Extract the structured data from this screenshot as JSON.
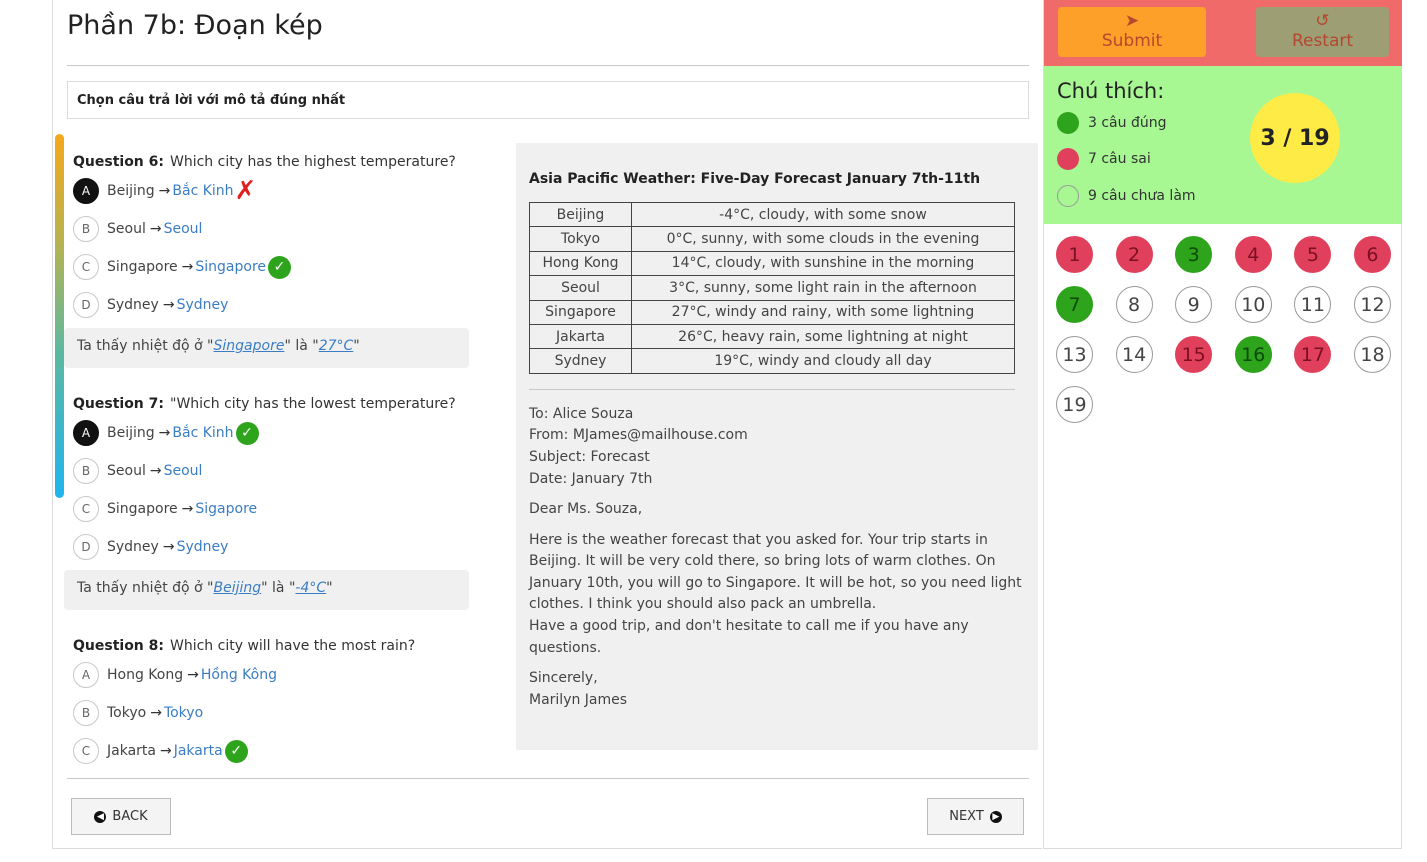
{
  "page_title": "Phần 7b: Đoạn kép",
  "instruction": "Chọn câu trả lời với mô tả đúng nhất",
  "questions": [
    {
      "label": "Question 6:",
      "text": "Which city has the highest temperature?",
      "options": [
        {
          "letter": "A",
          "text": "Beijing",
          "translation": "Bắc Kinh",
          "selected": true,
          "mark": "wrong"
        },
        {
          "letter": "B",
          "text": "Seoul",
          "translation": "Seoul",
          "selected": false,
          "mark": ""
        },
        {
          "letter": "C",
          "text": "Singapore",
          "translation": "Singapore",
          "selected": false,
          "mark": "correct"
        },
        {
          "letter": "D",
          "text": "Sydney",
          "translation": "Sydney",
          "selected": false,
          "mark": ""
        }
      ],
      "explain_prefix": "Ta thấy nhiệt độ ở \"",
      "explain_city": "Singapore",
      "explain_mid": "\" là \"",
      "explain_value": "27°C",
      "explain_suffix": "\""
    },
    {
      "label": "Question 7:",
      "text": "\"Which city has the lowest temperature?",
      "options": [
        {
          "letter": "A",
          "text": "Beijing",
          "translation": "Bắc Kinh",
          "selected": true,
          "mark": "correct"
        },
        {
          "letter": "B",
          "text": "Seoul",
          "translation": "Seoul",
          "selected": false,
          "mark": ""
        },
        {
          "letter": "C",
          "text": "Singapore",
          "translation": "Sigapore",
          "selected": false,
          "mark": ""
        },
        {
          "letter": "D",
          "text": "Sydney",
          "translation": "Sydney",
          "selected": false,
          "mark": ""
        }
      ],
      "explain_prefix": "Ta thấy nhiệt độ ở \"",
      "explain_city": "Beijing",
      "explain_mid": "\" là \"",
      "explain_value": "-4°C",
      "explain_suffix": "\""
    },
    {
      "label": "Question 8:",
      "text": "Which city will have the most rain?",
      "options": [
        {
          "letter": "A",
          "text": "Hong Kong",
          "translation": "Hồng Kông",
          "selected": false,
          "mark": ""
        },
        {
          "letter": "B",
          "text": "Tokyo",
          "translation": "Tokyo",
          "selected": false,
          "mark": ""
        },
        {
          "letter": "C",
          "text": "Jakarta",
          "translation": "Jakarta",
          "selected": false,
          "mark": "correct"
        }
      ]
    }
  ],
  "passage": {
    "title": "Asia Pacific Weather: Five-Day Forecast January 7th-11th",
    "table": [
      [
        "Beijing",
        "-4°C, cloudy, with some snow"
      ],
      [
        "Tokyo",
        "0°C, sunny, with some clouds in the evening"
      ],
      [
        "Hong Kong",
        "14°C, cloudy, with sunshine in the morning"
      ],
      [
        "Seoul",
        "3°C, sunny, some light rain in the afternoon"
      ],
      [
        "Singapore",
        "27°C, windy and rainy, with some lightning"
      ],
      [
        "Jakarta",
        "26°C, heavy rain, some lightning at night"
      ],
      [
        "Sydney",
        "19°C, windy and cloudy all day"
      ]
    ],
    "email": {
      "to": "To: Alice Souza",
      "from": "From: MJames@mailhouse.com",
      "subject": "Subject: Forecast",
      "date": "Date: January 7th",
      "greeting": "Dear Ms. Souza,",
      "body1": "Here is the weather forecast that you asked for. Your trip starts in Beijing. It will be very cold there, so bring lots of warm clothes. On January 10th, you will go to Singapore. It will be hot, so you need light clothes. I think you should also pack an umbrella.",
      "body2": "Have a good trip, and don't hesitate to call me if you have any questions.",
      "closing": "Sincerely,",
      "signature": "Marilyn James"
    }
  },
  "nav": {
    "back_label": "BACK",
    "next_label": "NEXT"
  },
  "sidebar": {
    "submit_label": "Submit",
    "restart_label": "Restart",
    "legend_title": "Chú thích:",
    "legend_correct": "3 câu đúng",
    "legend_wrong": "7 câu sai",
    "legend_unanswered": "9 câu chưa làm",
    "score": "3 / 19",
    "question_numbers": [
      {
        "n": "1",
        "state": "wrong"
      },
      {
        "n": "2",
        "state": "wrong"
      },
      {
        "n": "3",
        "state": "correct"
      },
      {
        "n": "4",
        "state": "wrong"
      },
      {
        "n": "5",
        "state": "wrong"
      },
      {
        "n": "6",
        "state": "wrong"
      },
      {
        "n": "7",
        "state": "correct"
      },
      {
        "n": "8",
        "state": "none"
      },
      {
        "n": "9",
        "state": "none"
      },
      {
        "n": "10",
        "state": "none"
      },
      {
        "n": "11",
        "state": "none"
      },
      {
        "n": "12",
        "state": "none"
      },
      {
        "n": "13",
        "state": "none"
      },
      {
        "n": "14",
        "state": "none"
      },
      {
        "n": "15",
        "state": "wrong"
      },
      {
        "n": "16",
        "state": "correct"
      },
      {
        "n": "17",
        "state": "wrong"
      },
      {
        "n": "18",
        "state": "none"
      },
      {
        "n": "19",
        "state": "none"
      }
    ]
  },
  "colors": {
    "correct": "#2ea31c",
    "wrong": "#e1405c",
    "accent": "#3b7dc4"
  },
  "icons": {
    "submit": "paper-plane-icon",
    "restart": "undo-icon",
    "back": "circle-arrow-left-icon",
    "next": "circle-arrow-right-icon"
  }
}
